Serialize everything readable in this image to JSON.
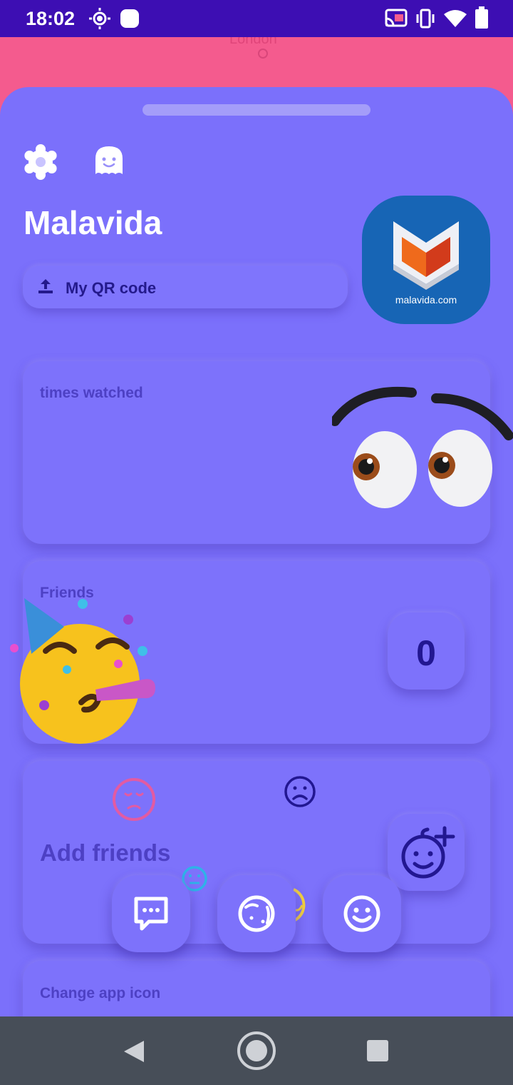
{
  "status_bar": {
    "time": "18:02",
    "icons": [
      "brightness-icon",
      "notification-icon",
      "cast-icon",
      "vibrate-icon",
      "wifi-icon",
      "battery-icon"
    ]
  },
  "map": {
    "city_label": "London"
  },
  "profile": {
    "name": "Malavida",
    "qr_button_label": "My QR code",
    "avatar_caption": "malavida.com"
  },
  "cards": {
    "times_watched": {
      "title": "times watched"
    },
    "friends": {
      "title": "Friends",
      "count": "0"
    },
    "add_friends": {
      "title": "Add friends"
    },
    "change_icon": {
      "title": "Change app icon"
    }
  },
  "bottom_actions": [
    "chat-icon",
    "planet-icon",
    "smiley-icon"
  ],
  "colors": {
    "status_bar": "#3d0eb3",
    "sheet": "#7b70fb",
    "map": "#f45b8e",
    "text_dark": "#241a8c",
    "nav_bar": "#474e58"
  }
}
